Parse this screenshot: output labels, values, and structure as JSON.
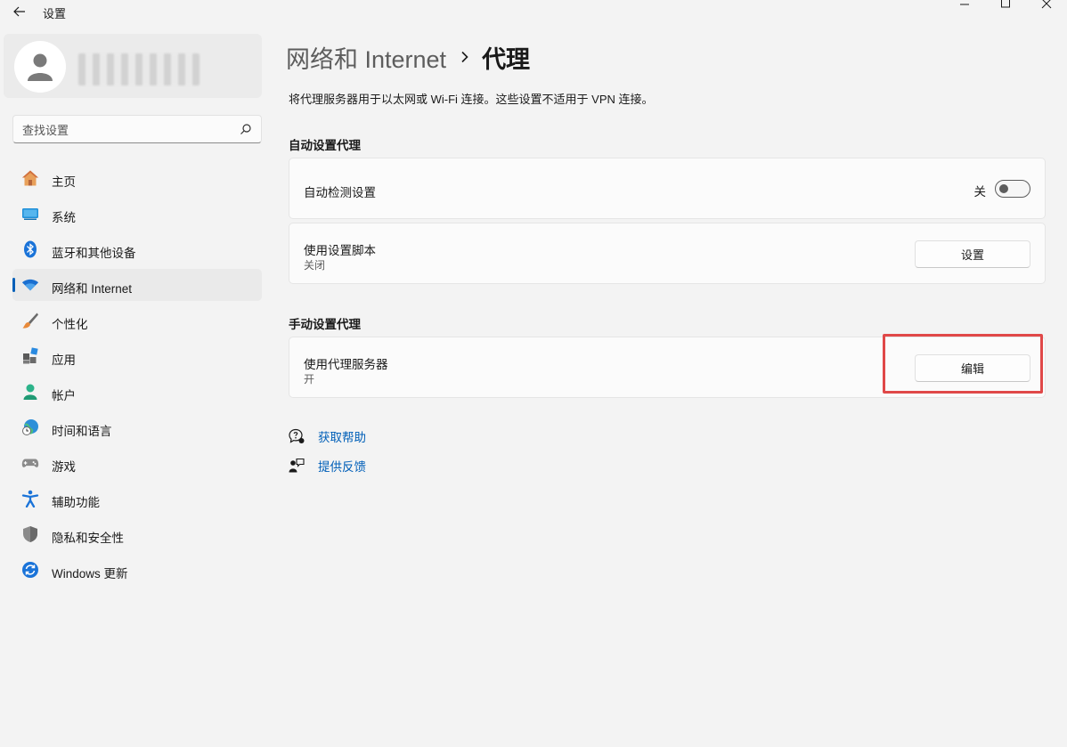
{
  "app": {
    "title": "设置"
  },
  "window_controls": {
    "minimize_icon": "minimize-icon",
    "maximize_icon": "maximize-icon",
    "close_icon": "close-icon"
  },
  "search": {
    "placeholder": "查找设置"
  },
  "sidebar": {
    "items": [
      {
        "label": "主页",
        "icon": "home-icon",
        "active": false
      },
      {
        "label": "系统",
        "icon": "system-icon",
        "active": false
      },
      {
        "label": "蓝牙和其他设备",
        "icon": "bluetooth-icon",
        "active": false
      },
      {
        "label": "网络和 Internet",
        "icon": "wifi-icon",
        "active": true
      },
      {
        "label": "个性化",
        "icon": "brush-icon",
        "active": false
      },
      {
        "label": "应用",
        "icon": "apps-icon",
        "active": false
      },
      {
        "label": "帐户",
        "icon": "account-icon",
        "active": false
      },
      {
        "label": "时间和语言",
        "icon": "globe-clock-icon",
        "active": false
      },
      {
        "label": "游戏",
        "icon": "gamepad-icon",
        "active": false
      },
      {
        "label": "辅助功能",
        "icon": "accessibility-icon",
        "active": false
      },
      {
        "label": "隐私和安全性",
        "icon": "shield-icon",
        "active": false
      },
      {
        "label": "Windows 更新",
        "icon": "update-icon",
        "active": false
      }
    ]
  },
  "breadcrumb": {
    "parent": "网络和 Internet",
    "current": "代理"
  },
  "description": "将代理服务器用于以太网或 Wi-Fi 连接。这些设置不适用于 VPN 连接。",
  "auto_section": {
    "title": "自动设置代理",
    "detect": {
      "label": "自动检测设置",
      "toggle_state": "关",
      "on": false
    },
    "script": {
      "label": "使用设置脚本",
      "status": "关闭",
      "button": "设置"
    }
  },
  "manual_section": {
    "title": "手动设置代理",
    "proxy": {
      "label": "使用代理服务器",
      "status": "开",
      "button": "编辑"
    }
  },
  "links": {
    "help": "获取帮助",
    "feedback": "提供反馈"
  },
  "colors": {
    "accent": "#005fb8",
    "highlight": "#e04848",
    "background": "#f3f3f3"
  }
}
